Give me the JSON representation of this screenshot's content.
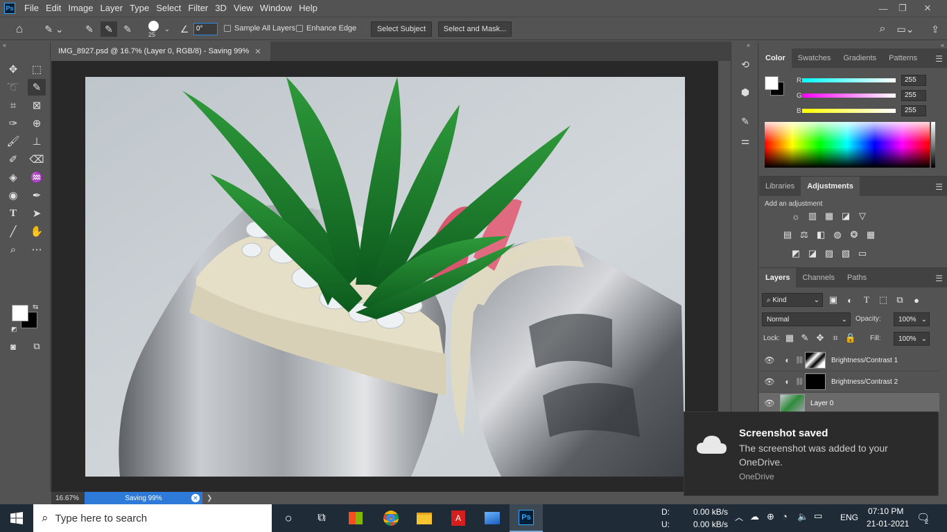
{
  "app": {
    "logo": "Ps",
    "menu": [
      "File",
      "Edit",
      "Image",
      "Layer",
      "Type",
      "Select",
      "Filter",
      "3D",
      "View",
      "Window",
      "Help"
    ],
    "window_controls": {
      "minimize": "—",
      "restore": "❐",
      "close": "✕"
    }
  },
  "options": {
    "brush_size": "25",
    "angle_value": "0°",
    "sample_all_layers": "Sample All Layers",
    "enhance_edge": "Enhance Edge",
    "select_subject": "Select Subject",
    "select_and_mask": "Select and Mask..."
  },
  "document": {
    "tab_title": "IMG_8927.psd @ 16.7% (Layer 0, RGB/8) - Saving 99%",
    "close": "✕",
    "zoom": "16.67%",
    "progress_label": "Saving 99%",
    "progress": 0.99
  },
  "color_panel": {
    "tabs": [
      "Color",
      "Swatches",
      "Gradients",
      "Patterns"
    ],
    "r_label": "R",
    "g_label": "G",
    "b_label": "B",
    "r": "255",
    "g": "255",
    "b": "255"
  },
  "adjust_panel": {
    "tabs": [
      "Libraries",
      "Adjustments"
    ],
    "add_label": "Add an adjustment"
  },
  "layers_panel": {
    "tabs": [
      "Layers",
      "Channels",
      "Paths"
    ],
    "kind": "Kind",
    "blend": "Normal",
    "opacity_label": "Opacity:",
    "opacity": "100%",
    "lock_label": "Lock:",
    "fill_label": "Fill:",
    "fill": "100%",
    "layers": [
      {
        "name": "Brightness/Contrast 1"
      },
      {
        "name": "Brightness/Contrast 2"
      },
      {
        "name": "Layer 0"
      }
    ]
  },
  "toast": {
    "title": "Screenshot saved",
    "body": "The screenshot was added to your OneDrive.",
    "source": "OneDrive"
  },
  "taskbar": {
    "search_placeholder": "Type here to search",
    "net_d_label": "D:",
    "net_u_label": "U:",
    "net_d": "0.00 kB/s",
    "net_u": "0.00 kB/s",
    "lang": "ENG",
    "time": "07:10 PM",
    "date": "21-01-2021",
    "notif_count": "2"
  }
}
